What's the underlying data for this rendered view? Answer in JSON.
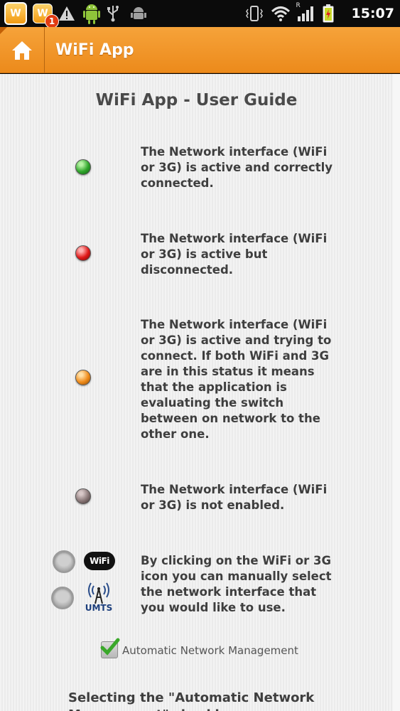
{
  "status_bar": {
    "time": "15:07",
    "notification_count": "1",
    "app_tile_glyph": "W",
    "icons": [
      "warning-icon",
      "android-icon",
      "usb-icon",
      "debug-icon",
      "vibrate-icon",
      "wifi-icon",
      "signal-icon",
      "battery-icon"
    ],
    "signal_roaming_marker": "R"
  },
  "action_bar": {
    "title": "WiFi App",
    "accent_color": "#F09428"
  },
  "guide": {
    "title": "WiFi App - User Guide",
    "items": [
      {
        "status_color": "green",
        "text": "The Network interface (WiFi or 3G) is active and correctly connected."
      },
      {
        "status_color": "red",
        "text": "The Network interface (WiFi or 3G) is active but disconnected."
      },
      {
        "status_color": "orange",
        "text": "The Network interface (WiFi or 3G) is active and trying to connect. If both WiFi and 3G are in this status it means that the application is evaluating the switch between on network to the other one."
      },
      {
        "status_color": "grey",
        "text": "The Network interface (WiFi or 3G) is not enabled."
      }
    ],
    "manual_select": {
      "wifi_icon_label": "WiFi",
      "umts_icon_label": "UMTS",
      "text": "By clicking on the WiFi or 3G icon you can manually select the network interface that you would like to use."
    },
    "auto_management": {
      "label": "Automatic Network Management",
      "checked": true
    },
    "bottom_text": "Selecting the \"Automatic Network Management\" checkbox you can enable"
  }
}
